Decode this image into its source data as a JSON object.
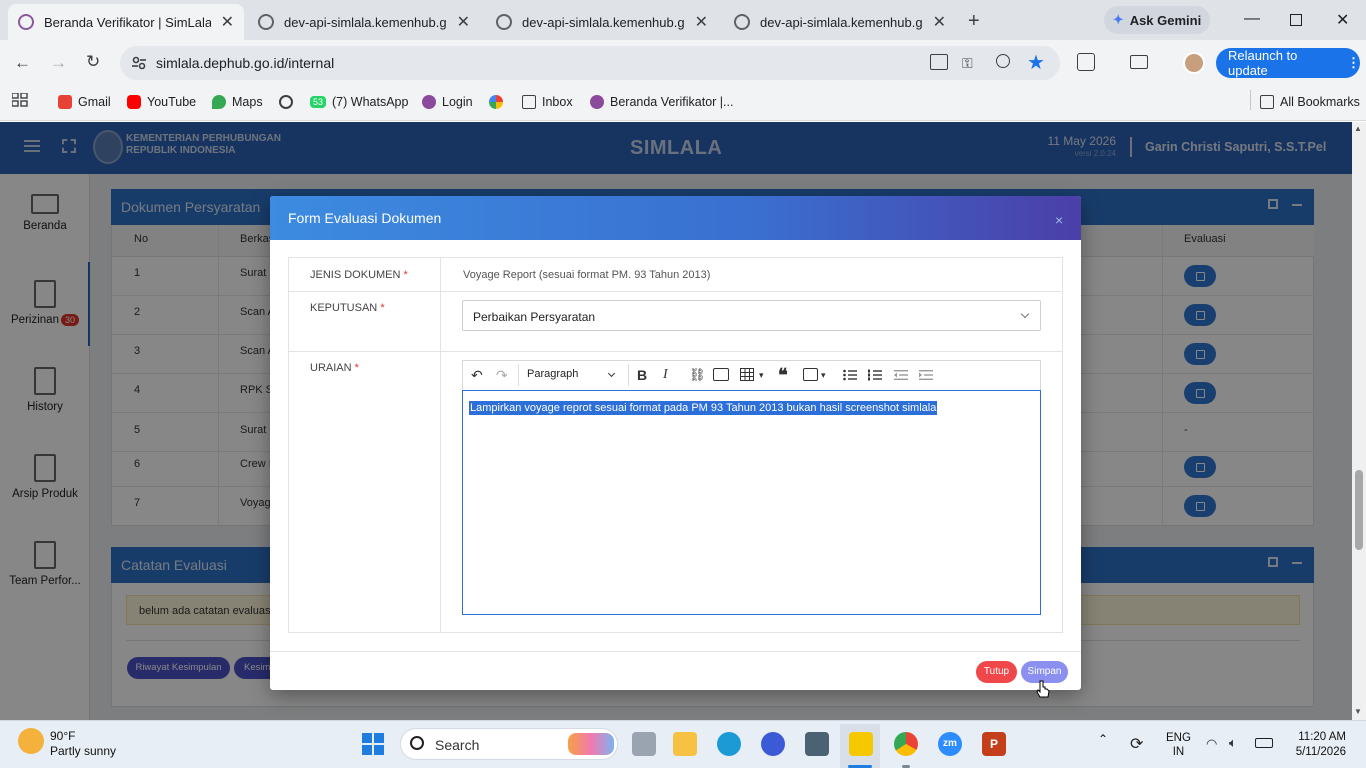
{
  "browser": {
    "tabs": [
      {
        "title": "Beranda Verifikator | SimLala",
        "active": true
      },
      {
        "title": "dev-api-simlala.kemenhub.go.id",
        "active": false
      },
      {
        "title": "dev-api-simlala.kemenhub.go.id",
        "active": false
      },
      {
        "title": "dev-api-simlala.kemenhub.go.id",
        "active": false
      }
    ],
    "ask_gemini": "Ask Gemini",
    "url": "simlala.dephub.go.id/internal",
    "relaunch": "Relaunch to update",
    "bookmarks": [
      "Gmail",
      "YouTube",
      "Maps",
      "(7) WhatsApp",
      "Login",
      "Inbox",
      "Beranda Verifikator |..."
    ],
    "whatsapp_badge": "53",
    "all_bookmarks": "All Bookmarks"
  },
  "app": {
    "brand_line1": "KEMENTERIAN PERHUBUNGAN",
    "brand_line2": "REPUBLIK INDONESIA",
    "title": "SIMLALA",
    "date": "11 May 2026",
    "version": "versi 2.0.24",
    "user": "Garin Christi Saputri, S.S.T.Pel"
  },
  "sidebar": {
    "items": [
      {
        "label": "Beranda"
      },
      {
        "label": "Perizinan",
        "badge": "30"
      },
      {
        "label": "History"
      },
      {
        "label": "Arsip Produk"
      },
      {
        "label": "Team Perfor..."
      }
    ]
  },
  "documents_panel": {
    "title": "Dokumen Persyaratan",
    "col_no": "No",
    "col_berkas": "Berkas",
    "col_evaluasi": "Evaluasi",
    "rows": [
      {
        "no": "1",
        "berkas": "Surat P",
        "eval": "edit"
      },
      {
        "no": "2",
        "berkas": "Scan A",
        "eval": "edit"
      },
      {
        "no": "3",
        "berkas": "Scan A",
        "eval": "edit"
      },
      {
        "no": "4",
        "berkas": "RPK Se",
        "eval": "edit"
      },
      {
        "no": "5",
        "berkas": "Surat D",
        "eval": "-"
      },
      {
        "no": "6",
        "berkas": "Crew Il",
        "eval": "edit"
      },
      {
        "no": "7",
        "berkas": "Voyage",
        "eval": "edit"
      }
    ]
  },
  "catatan_panel": {
    "title": "Catatan Evaluasi",
    "empty_text": "belum ada catatan evaluasi",
    "btn_riwayat": "Riwayat Kesimpulan",
    "btn_kesim": "Kesim"
  },
  "modal": {
    "title": "Form Evaluasi Dokumen",
    "close": "×",
    "jenis_label": "JENIS DOKUMEN",
    "jenis_value": "Voyage Report (sesuai format PM. 93 Tahun 2013)",
    "keputusan_label": "KEPUTUSAN",
    "keputusan_value": "Perbaikan Persyaratan",
    "uraian_label": "URAIAN",
    "required_mark": "*",
    "toolbar_paragraph": "Paragraph",
    "editor_text": "Lampirkan voyage reprot sesuai format pada PM 93 Tahun 2013 bukan hasil screenshot simlala",
    "btn_tutup": "Tutup",
    "btn_simpan": "Simpan"
  },
  "taskbar": {
    "temp": "90°F",
    "weather": "Partly sunny",
    "search_placeholder": "Search",
    "lang1": "ENG",
    "lang2": "IN",
    "time": "11:20 AM",
    "date": "5/11/2026"
  }
}
